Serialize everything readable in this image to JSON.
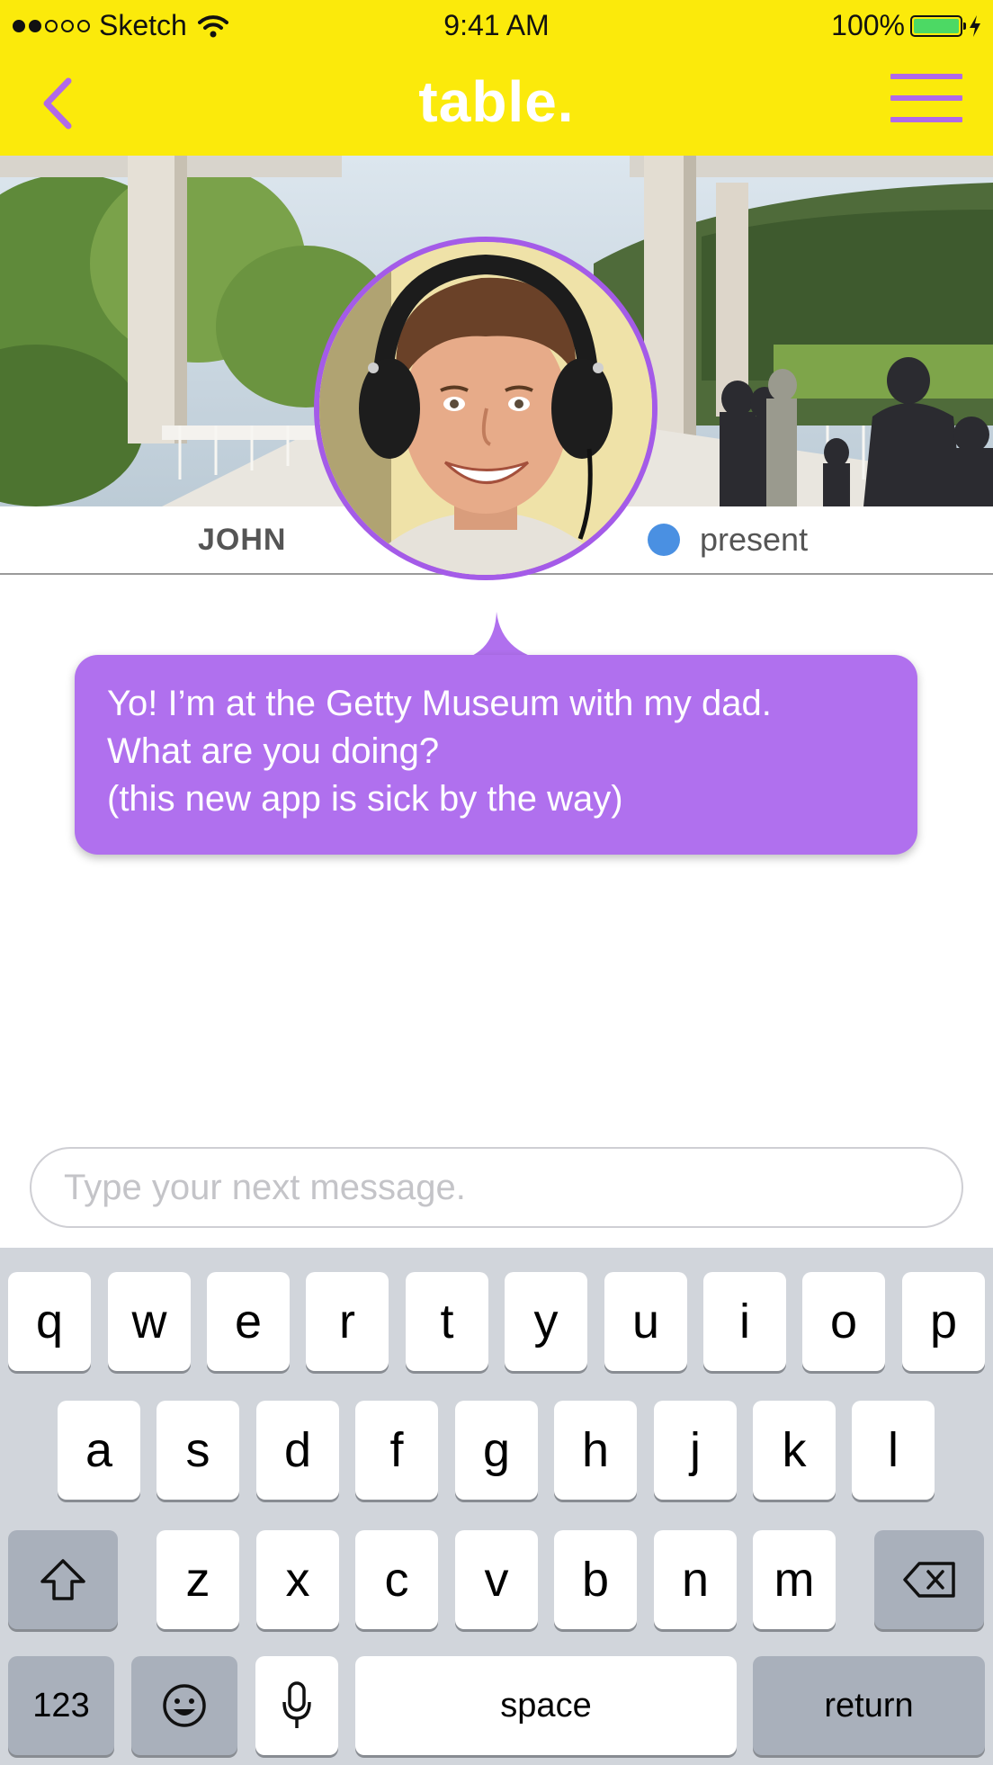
{
  "status_bar": {
    "carrier": "Sketch",
    "time": "9:41 AM",
    "battery_percent": "100%",
    "signal_bars_filled": 2,
    "signal_bars_total": 5
  },
  "nav": {
    "title": "table."
  },
  "profile": {
    "name": "JOHN",
    "status_label": "present",
    "status_color": "#4A90E2"
  },
  "message": {
    "line1": "Yo! I’m at the Getty Museum with my dad.",
    "line2": "What are you doing?",
    "line3": "(this new app is sick by the way)"
  },
  "composer": {
    "placeholder": "Type your next message."
  },
  "keyboard": {
    "row1": [
      "q",
      "w",
      "e",
      "r",
      "t",
      "y",
      "u",
      "i",
      "o",
      "p"
    ],
    "row2": [
      "a",
      "s",
      "d",
      "f",
      "g",
      "h",
      "j",
      "k",
      "l"
    ],
    "row3": [
      "z",
      "x",
      "c",
      "v",
      "b",
      "n",
      "m"
    ],
    "numbers_label": "123",
    "space_label": "space",
    "return_label": "return"
  },
  "colors": {
    "brand_yellow": "#FBEA0B",
    "accent_purple": "#B070EE",
    "keyboard_bg": "#D1D5DB"
  }
}
